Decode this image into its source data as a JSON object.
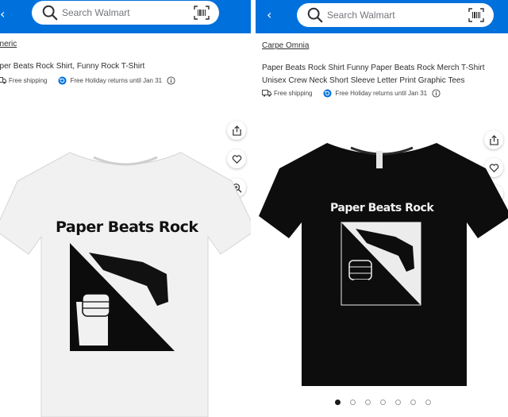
{
  "left_panel": {
    "back_glyph": "‹",
    "search_placeholder": "Search Walmart",
    "seller": "eneric",
    "title": "aper Beats Rock Shirt, Funny Rock T-Shirt",
    "shipping": "Free shipping",
    "returns": "Free Holiday returns until Jan 31",
    "shirt_color": "#f1f1f1",
    "shirt_text": "Paper Beats Rock"
  },
  "right_panel": {
    "back_glyph": "‹",
    "search_placeholder": "Search Walmart",
    "seller": "Carpe Omnia",
    "title": "Paper Beats Rock Shirt Funny Paper Beats Rock Merch T-Shirt Unisex Crew Neck Short Sleeve Letter Print Graphic Tees",
    "shipping": "Free shipping",
    "returns": "Free Holiday returns until Jan 31",
    "shirt_color": "#0d0d0d",
    "shirt_text": "Paper Beats Rock",
    "carousel_total": 7,
    "carousel_active": 1
  },
  "colors": {
    "walmart_blue": "#0071dc",
    "text_dark": "#2e2f32",
    "returns_icon": "#0071dc"
  },
  "icons": {
    "search": "search-icon",
    "barcode": "barcode-scanner-icon",
    "share": "share-icon",
    "favorite": "heart-icon",
    "zoom": "zoom-in-icon",
    "shipping": "truck-icon",
    "returns": "returns-icon",
    "info": "info-icon"
  }
}
